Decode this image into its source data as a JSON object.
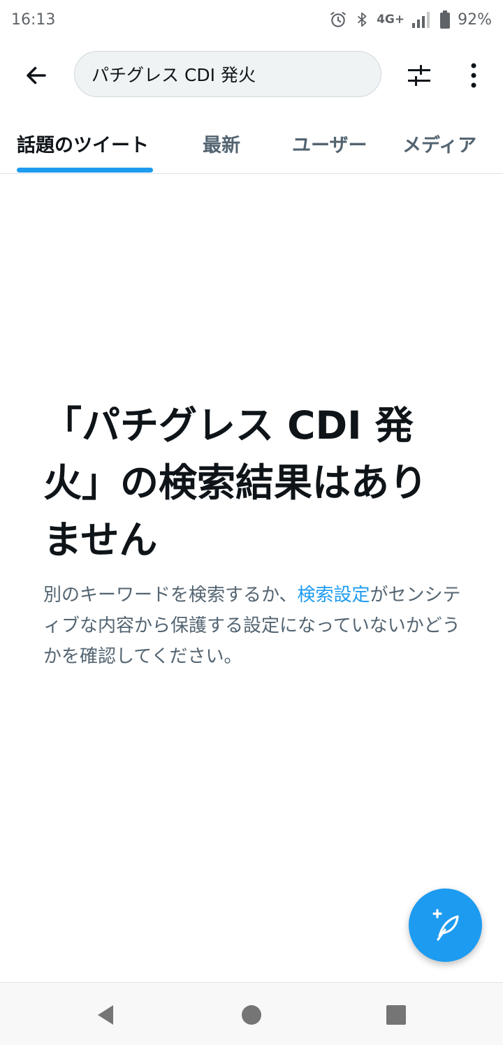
{
  "status_bar": {
    "time": "16:13",
    "network": "4G+",
    "battery": "92%",
    "icons": [
      "alarm-icon",
      "bluetooth-icon",
      "signal-icon",
      "battery-icon"
    ]
  },
  "app_bar": {
    "search_query": "パチグレス CDI 発火",
    "icons": [
      "back-arrow-icon",
      "filter-sliders-icon",
      "more-vertical-icon"
    ]
  },
  "tabs": [
    {
      "label": "話題のツイート",
      "active": true
    },
    {
      "label": "最新",
      "active": false
    },
    {
      "label": "ユーザー",
      "active": false
    },
    {
      "label": "メディア",
      "active": false
    }
  ],
  "empty_state": {
    "title": "「パチグレス CDI 発火」の検索結果はありません",
    "desc_before": "別のキーワードを検索するか、",
    "desc_link": "検索設定",
    "desc_after": "がセンシティブな内容から保護する設定になっていないかどうかを確認してください。"
  },
  "fab": {
    "icon": "compose-tweet-icon"
  },
  "nav_bar": {
    "icons": [
      "nav-back-icon",
      "nav-home-icon",
      "nav-recents-icon"
    ]
  },
  "colors": {
    "accent": "#1d9bf0",
    "text_primary": "#0f1419",
    "text_secondary": "#536471"
  }
}
